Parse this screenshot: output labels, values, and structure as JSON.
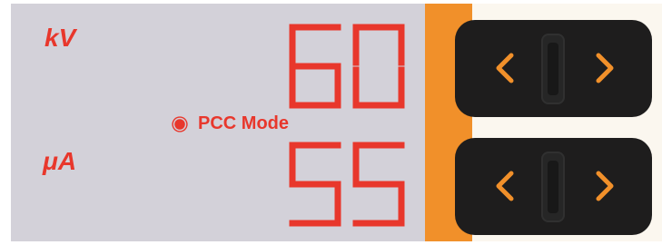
{
  "display": {
    "voltage_unit": "kV",
    "voltage_value": "60",
    "current_unit": "μA",
    "current_value": "55",
    "mode_label": "PCC Mode"
  },
  "colors": {
    "display_background": "#d3d1d9",
    "segment_red": "#e8372c",
    "accent_orange": "#f1902a",
    "control_dark": "#1e1d1d"
  },
  "controls": {
    "voltage": {
      "decrease_icon": "chevron-left-icon",
      "increase_icon": "chevron-right-icon"
    },
    "current": {
      "decrease_icon": "chevron-left-icon",
      "increase_icon": "chevron-right-icon"
    }
  }
}
